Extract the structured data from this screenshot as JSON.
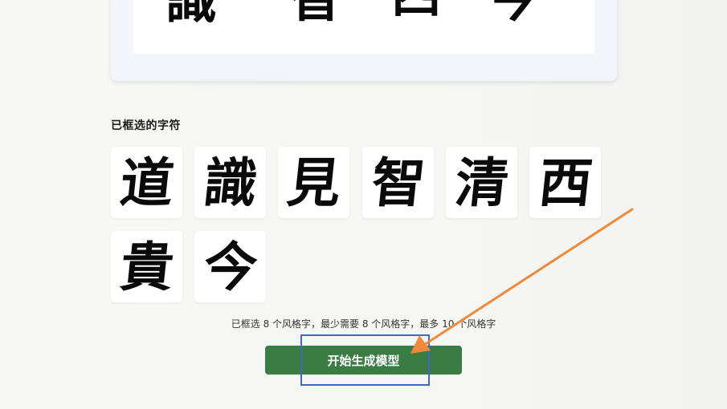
{
  "preview": {
    "strip_chars": [
      "識",
      "智",
      "西",
      "今"
    ]
  },
  "selected": {
    "title": "已框选的字符",
    "chars": [
      "道",
      "識",
      "見",
      "智",
      "清",
      "西",
      "貴",
      "今"
    ]
  },
  "status": {
    "text": "已框选 8 个风格字，最少需要 8 个风格字，最多 10 个风格字"
  },
  "actions": {
    "start_label": "开始生成模型"
  },
  "annotation": {
    "box_color": "#4466c4",
    "arrow_color": "#f0893a"
  },
  "colors": {
    "button_bg": "#3a7d44",
    "button_text": "#ffffff"
  }
}
